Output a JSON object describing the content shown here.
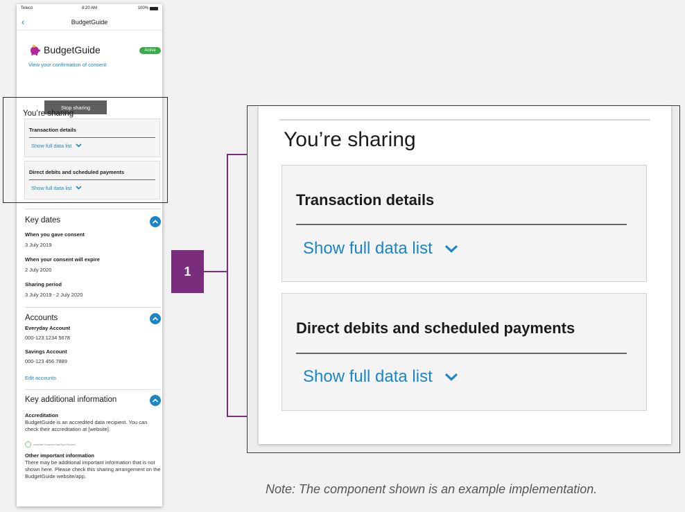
{
  "status_bar": {
    "carrier": "Teleco",
    "time": "8:20 AM",
    "battery": "100%"
  },
  "nav": {
    "title": "BudgetGuide"
  },
  "app": {
    "name": "BudgetGuide",
    "status": "Active",
    "consent_link": "View your confirmation of consent",
    "stop_button": "Stop sharing"
  },
  "sharing": {
    "title": "You’re sharing",
    "items": [
      {
        "title": "Transaction details",
        "link": "Show full data list"
      },
      {
        "title": "Direct debits and scheduled payments",
        "link": "Show full data list"
      }
    ]
  },
  "key_dates": {
    "title": "Key dates",
    "items": [
      {
        "label": "When you gave consent",
        "value": "3 July 2019"
      },
      {
        "label": "When your consent will expire",
        "value": "2 July 2020"
      },
      {
        "label": "Sharing period",
        "value": "3 July 2019 - 2 July 2020"
      }
    ]
  },
  "accounts": {
    "title": "Accounts",
    "items": [
      {
        "label": "Everyday Account",
        "value": "000-123 1234 5678"
      },
      {
        "label": "Savings Account",
        "value": "000-123 456 7889"
      }
    ],
    "edit_link": "Edit accounts"
  },
  "key_info": {
    "title": "Key additional information",
    "accreditation_label": "Accreditation",
    "accreditation_text": "BudgetGuide is an accredited data recipient. You can check their accreditation at [website].",
    "seal_text": "Accredited Consumer Data Right Recipient",
    "other_label": "Other important information",
    "other_text": "There may be additional important information that is not shown here. Please check this sharing arrangement on the BudgetGuide website/app."
  },
  "callout": {
    "number": "1"
  },
  "note": "Note: The component shown is an example implementation.",
  "colors": {
    "accent": "#1a86c8",
    "callout": "#7b2d7d",
    "active_badge": "#3aaa4a",
    "stop_button": "#5f5f5f"
  }
}
